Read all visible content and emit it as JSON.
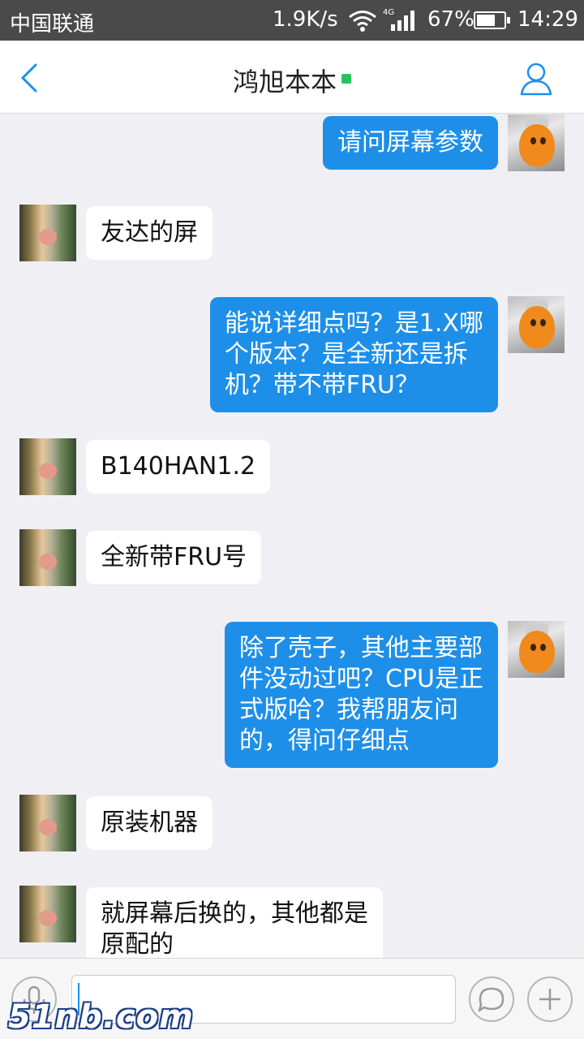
{
  "status_bar": {
    "carrier": "中国联通",
    "net_speed": "1.9K/s",
    "network_type": "4G",
    "battery": "67%",
    "time": "14:29"
  },
  "header": {
    "title": "鸿旭本本",
    "online_color": "#22c55e"
  },
  "messages": [
    {
      "from": "me",
      "text": "请问屏幕参数"
    },
    {
      "from": "other",
      "text": "友达的屏"
    },
    {
      "from": "me",
      "text": "能说详细点吗？是1.X哪\n个版本？是全新还是拆\n机？带不带FRU？"
    },
    {
      "from": "other",
      "text": "B140HAN1.2"
    },
    {
      "from": "other",
      "text": "全新带FRU号"
    },
    {
      "from": "me",
      "text": "除了壳子，其他主要部\n件没动过吧？CPU是正\n式版哈？我帮朋友问\n的，得问仔细点"
    },
    {
      "from": "other",
      "text": "原装机器"
    },
    {
      "from": "other",
      "text": "就屏幕后换的，其他都是\n原配的"
    }
  ],
  "input": {
    "placeholder": ""
  },
  "watermark": "51nb.com",
  "colors": {
    "my_bubble": "#1e8fe8",
    "other_bubble": "#ffffff",
    "accent": "#1e8fe8"
  }
}
